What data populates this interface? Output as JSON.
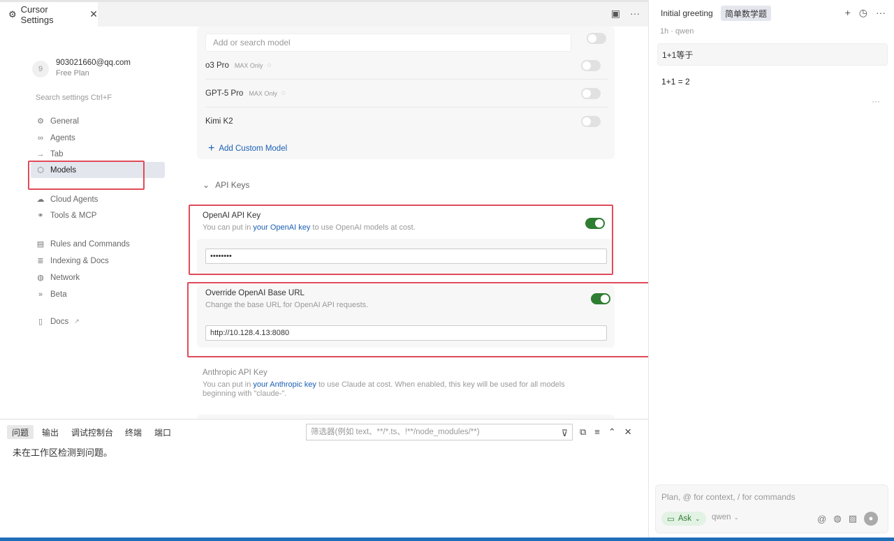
{
  "tab": {
    "title": "Cursor Settings"
  },
  "account": {
    "avatar": "9",
    "email": "903021660@qq.com",
    "plan": "Free Plan"
  },
  "nav": {
    "search_placeholder": "Search settings Ctrl+F",
    "items": [
      {
        "label": "General",
        "icon": "gear-icon"
      },
      {
        "label": "Agents",
        "icon": "infinity-icon"
      },
      {
        "label": "Tab",
        "icon": "arrow-right-icon"
      },
      {
        "label": "Models",
        "icon": "cube-icon"
      },
      {
        "label": "Cloud Agents",
        "icon": "cloud-icon"
      },
      {
        "label": "Tools & MCP",
        "icon": "tools-icon"
      },
      {
        "label": "Rules and Commands",
        "icon": "document-icon"
      },
      {
        "label": "Indexing & Docs",
        "icon": "database-icon"
      },
      {
        "label": "Network",
        "icon": "globe-icon"
      },
      {
        "label": "Beta",
        "icon": "double-chevron-icon"
      },
      {
        "label": "Docs",
        "icon": "book-icon"
      }
    ],
    "active": "Models"
  },
  "models": {
    "search_placeholder": "Add or search model",
    "rows": [
      {
        "name": "o3 Pro",
        "tag": "MAX Only",
        "enabled": false
      },
      {
        "name": "GPT-5 Pro",
        "tag": "MAX Only",
        "enabled": false
      },
      {
        "name": "Kimi K2",
        "tag": "",
        "enabled": false
      }
    ],
    "add_custom_label": "Add Custom Model"
  },
  "api_keys": {
    "section_title": "API Keys",
    "openai": {
      "title": "OpenAI API Key",
      "desc_prefix": "You can put in ",
      "desc_link": "your OpenAI key",
      "desc_suffix": " to use OpenAI models at cost.",
      "enabled": true,
      "value": "••••••••"
    },
    "override": {
      "title": "Override OpenAI Base URL",
      "desc": "Change the base URL for OpenAI API requests.",
      "enabled": true,
      "value": "http://10.128.4.13:8080"
    },
    "anthropic": {
      "title": "Anthropic API Key",
      "desc_prefix": "You can put in ",
      "desc_link": "your Anthropic key",
      "desc_suffix": " to use Claude at cost. When enabled, this key will be used for all models beginning with \"claude-\"."
    }
  },
  "panel": {
    "tabs": [
      "问题",
      "输出",
      "调试控制台",
      "终端",
      "端口"
    ],
    "filter_placeholder": "筛选器(例如 text、**/*.ts、!**/node_modules/**)",
    "message": "未在工作区检测到问题。"
  },
  "chat": {
    "tabs": [
      "Initial greeting",
      "简单数学题"
    ],
    "meta": "1h · qwen",
    "user_message": "1+1等于",
    "answer": "1+1 = 2",
    "composer_placeholder": "Plan, @ for context, / for commands",
    "mode_label": "Ask",
    "model_label": "qwen"
  },
  "colors": {
    "accent": "#1a5fb4",
    "toggle_on": "#2e7d32",
    "highlight": "#e04b5a",
    "statusbar": "#1e6fb8"
  }
}
